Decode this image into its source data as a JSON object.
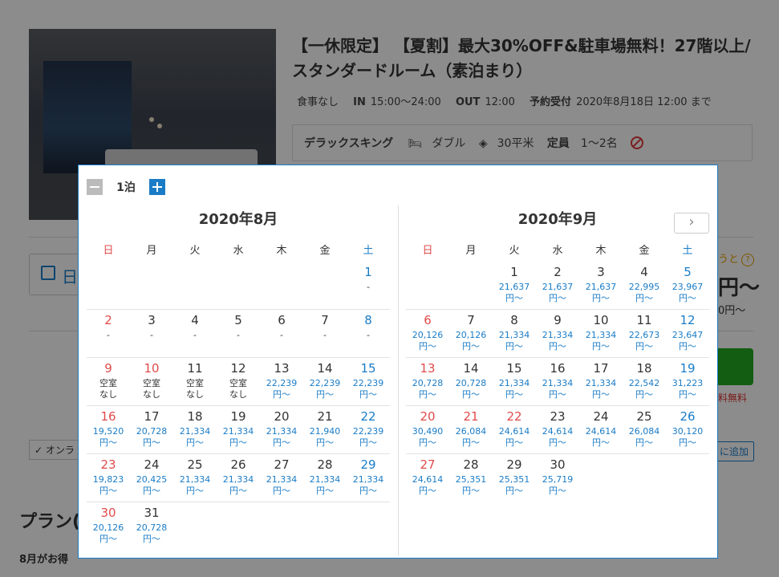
{
  "plan": {
    "title": "【一休限定】 【夏割】最大30%OFF&駐車場無料！27階以上/スタンダードルーム（素泊まり）",
    "meal": "食事なし",
    "in_label": "IN",
    "in_time": "15:00〜24:00",
    "out_label": "OUT",
    "out_time": "12:00",
    "deadline_label": "予約受付",
    "deadline": "2020年8月18日 12:00 まで"
  },
  "room": {
    "name": "デラックスキング",
    "bed": "ダブル",
    "size": "30平米",
    "capacity_label": "定員",
    "capacity": "1〜2名",
    "icons": [
      "bed-icon",
      "area-icon",
      "no-smoking-icon"
    ]
  },
  "background": {
    "date_label": "日",
    "price_note": "うと",
    "big_price": "円〜",
    "small_price": "0円〜",
    "free_note": "料無料",
    "online_tag": "✓ オンラ",
    "fav_button": "に追加",
    "plan_heading": "プラン(",
    "bottom_text": "8月がお得"
  },
  "calendar": {
    "nights_label": "1泊",
    "weekdays": [
      "日",
      "月",
      "火",
      "水",
      "木",
      "金",
      "土"
    ],
    "accent_colors": {
      "sunday": "#e04b4b",
      "saturday": "#1a7cc7",
      "price": "#1a7cc7"
    },
    "months": [
      {
        "title": "2020年8月",
        "weeks": [
          [
            null,
            null,
            null,
            null,
            null,
            null,
            {
              "d": "1",
              "p": "-",
              "t": "dash"
            }
          ],
          [
            {
              "d": "2",
              "p": "-",
              "t": "dash"
            },
            {
              "d": "3",
              "p": "-",
              "t": "dash"
            },
            {
              "d": "4",
              "p": "-",
              "t": "dash"
            },
            {
              "d": "5",
              "p": "-",
              "t": "dash"
            },
            {
              "d": "6",
              "p": "-",
              "t": "dash"
            },
            {
              "d": "7",
              "p": "-",
              "t": "dash"
            },
            {
              "d": "8",
              "p": "-",
              "t": "dash"
            }
          ],
          [
            {
              "d": "9",
              "p": "空室\nなし",
              "t": "na"
            },
            {
              "d": "10",
              "p": "空室\nなし",
              "t": "na",
              "hol": true
            },
            {
              "d": "11",
              "p": "空室\nなし",
              "t": "na"
            },
            {
              "d": "12",
              "p": "空室\nなし",
              "t": "na"
            },
            {
              "d": "13",
              "p": "22,239\n円〜"
            },
            {
              "d": "14",
              "p": "22,239\n円〜"
            },
            {
              "d": "15",
              "p": "22,239\n円〜"
            }
          ],
          [
            {
              "d": "16",
              "p": "19,520\n円〜"
            },
            {
              "d": "17",
              "p": "20,728\n円〜"
            },
            {
              "d": "18",
              "p": "21,334\n円〜"
            },
            {
              "d": "19",
              "p": "21,334\n円〜"
            },
            {
              "d": "20",
              "p": "21,334\n円〜"
            },
            {
              "d": "21",
              "p": "21,940\n円〜"
            },
            {
              "d": "22",
              "p": "22,239\n円〜"
            }
          ],
          [
            {
              "d": "23",
              "p": "19,823\n円〜"
            },
            {
              "d": "24",
              "p": "20,425\n円〜"
            },
            {
              "d": "25",
              "p": "21,334\n円〜"
            },
            {
              "d": "26",
              "p": "21,334\n円〜"
            },
            {
              "d": "27",
              "p": "21,334\n円〜"
            },
            {
              "d": "28",
              "p": "21,334\n円〜"
            },
            {
              "d": "29",
              "p": "21,334\n円〜"
            }
          ],
          [
            {
              "d": "30",
              "p": "20,126\n円〜"
            },
            {
              "d": "31",
              "p": "20,728\n円〜"
            },
            null,
            null,
            null,
            null,
            null
          ]
        ]
      },
      {
        "title": "2020年9月",
        "weeks": [
          [
            null,
            null,
            {
              "d": "1",
              "p": "21,637\n円〜"
            },
            {
              "d": "2",
              "p": "21,637\n円〜"
            },
            {
              "d": "3",
              "p": "21,637\n円〜"
            },
            {
              "d": "4",
              "p": "22,995\n円〜"
            },
            {
              "d": "5",
              "p": "23,967\n円〜"
            }
          ],
          [
            {
              "d": "6",
              "p": "20,126\n円〜"
            },
            {
              "d": "7",
              "p": "20,126\n円〜"
            },
            {
              "d": "8",
              "p": "21,334\n円〜"
            },
            {
              "d": "9",
              "p": "21,334\n円〜"
            },
            {
              "d": "10",
              "p": "21,334\n円〜"
            },
            {
              "d": "11",
              "p": "22,673\n円〜"
            },
            {
              "d": "12",
              "p": "23,647\n円〜"
            }
          ],
          [
            {
              "d": "13",
              "p": "20,728\n円〜"
            },
            {
              "d": "14",
              "p": "20,728\n円〜"
            },
            {
              "d": "15",
              "p": "21,334\n円〜"
            },
            {
              "d": "16",
              "p": "21,334\n円〜"
            },
            {
              "d": "17",
              "p": "21,334\n円〜"
            },
            {
              "d": "18",
              "p": "22,542\n円〜"
            },
            {
              "d": "19",
              "p": "31,223\n円〜"
            }
          ],
          [
            {
              "d": "20",
              "p": "30,490\n円〜"
            },
            {
              "d": "21",
              "p": "26,084\n円〜",
              "hol": true
            },
            {
              "d": "22",
              "p": "24,614\n円〜",
              "hol": true
            },
            {
              "d": "23",
              "p": "24,614\n円〜"
            },
            {
              "d": "24",
              "p": "24,614\n円〜"
            },
            {
              "d": "25",
              "p": "26,084\n円〜"
            },
            {
              "d": "26",
              "p": "30,120\n円〜"
            }
          ],
          [
            {
              "d": "27",
              "p": "24,614\n円〜"
            },
            {
              "d": "28",
              "p": "25,351\n円〜"
            },
            {
              "d": "29",
              "p": "25,351\n円〜"
            },
            {
              "d": "30",
              "p": "25,719\n円〜"
            },
            null,
            null,
            null
          ]
        ]
      }
    ]
  }
}
